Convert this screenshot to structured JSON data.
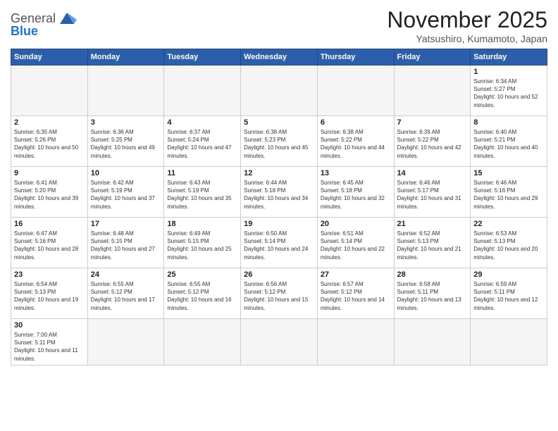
{
  "header": {
    "logo_general": "General",
    "logo_blue": "Blue",
    "title": "November 2025",
    "subtitle": "Yatsushiro, Kumamoto, Japan"
  },
  "weekdays": [
    "Sunday",
    "Monday",
    "Tuesday",
    "Wednesday",
    "Thursday",
    "Friday",
    "Saturday"
  ],
  "weeks": [
    [
      {
        "day": "",
        "info": ""
      },
      {
        "day": "",
        "info": ""
      },
      {
        "day": "",
        "info": ""
      },
      {
        "day": "",
        "info": ""
      },
      {
        "day": "",
        "info": ""
      },
      {
        "day": "",
        "info": ""
      },
      {
        "day": "1",
        "info": "Sunrise: 6:34 AM\nSunset: 5:27 PM\nDaylight: 10 hours and 52 minutes."
      }
    ],
    [
      {
        "day": "2",
        "info": "Sunrise: 6:35 AM\nSunset: 5:26 PM\nDaylight: 10 hours and 50 minutes."
      },
      {
        "day": "3",
        "info": "Sunrise: 6:36 AM\nSunset: 5:25 PM\nDaylight: 10 hours and 49 minutes."
      },
      {
        "day": "4",
        "info": "Sunrise: 6:37 AM\nSunset: 5:24 PM\nDaylight: 10 hours and 47 minutes."
      },
      {
        "day": "5",
        "info": "Sunrise: 6:38 AM\nSunset: 5:23 PM\nDaylight: 10 hours and 45 minutes."
      },
      {
        "day": "6",
        "info": "Sunrise: 6:38 AM\nSunset: 5:22 PM\nDaylight: 10 hours and 44 minutes."
      },
      {
        "day": "7",
        "info": "Sunrise: 6:39 AM\nSunset: 5:22 PM\nDaylight: 10 hours and 42 minutes."
      },
      {
        "day": "8",
        "info": "Sunrise: 6:40 AM\nSunset: 5:21 PM\nDaylight: 10 hours and 40 minutes."
      }
    ],
    [
      {
        "day": "9",
        "info": "Sunrise: 6:41 AM\nSunset: 5:20 PM\nDaylight: 10 hours and 39 minutes."
      },
      {
        "day": "10",
        "info": "Sunrise: 6:42 AM\nSunset: 5:19 PM\nDaylight: 10 hours and 37 minutes."
      },
      {
        "day": "11",
        "info": "Sunrise: 6:43 AM\nSunset: 5:19 PM\nDaylight: 10 hours and 35 minutes."
      },
      {
        "day": "12",
        "info": "Sunrise: 6:44 AM\nSunset: 5:18 PM\nDaylight: 10 hours and 34 minutes."
      },
      {
        "day": "13",
        "info": "Sunrise: 6:45 AM\nSunset: 5:18 PM\nDaylight: 10 hours and 32 minutes."
      },
      {
        "day": "14",
        "info": "Sunrise: 6:46 AM\nSunset: 5:17 PM\nDaylight: 10 hours and 31 minutes."
      },
      {
        "day": "15",
        "info": "Sunrise: 6:46 AM\nSunset: 5:16 PM\nDaylight: 10 hours and 29 minutes."
      }
    ],
    [
      {
        "day": "16",
        "info": "Sunrise: 6:47 AM\nSunset: 5:16 PM\nDaylight: 10 hours and 28 minutes."
      },
      {
        "day": "17",
        "info": "Sunrise: 6:48 AM\nSunset: 5:15 PM\nDaylight: 10 hours and 27 minutes."
      },
      {
        "day": "18",
        "info": "Sunrise: 6:49 AM\nSunset: 5:15 PM\nDaylight: 10 hours and 25 minutes."
      },
      {
        "day": "19",
        "info": "Sunrise: 6:50 AM\nSunset: 5:14 PM\nDaylight: 10 hours and 24 minutes."
      },
      {
        "day": "20",
        "info": "Sunrise: 6:51 AM\nSunset: 5:14 PM\nDaylight: 10 hours and 22 minutes."
      },
      {
        "day": "21",
        "info": "Sunrise: 6:52 AM\nSunset: 5:13 PM\nDaylight: 10 hours and 21 minutes."
      },
      {
        "day": "22",
        "info": "Sunrise: 6:53 AM\nSunset: 5:13 PM\nDaylight: 10 hours and 20 minutes."
      }
    ],
    [
      {
        "day": "23",
        "info": "Sunrise: 6:54 AM\nSunset: 5:13 PM\nDaylight: 10 hours and 19 minutes."
      },
      {
        "day": "24",
        "info": "Sunrise: 6:55 AM\nSunset: 5:12 PM\nDaylight: 10 hours and 17 minutes."
      },
      {
        "day": "25",
        "info": "Sunrise: 6:55 AM\nSunset: 5:12 PM\nDaylight: 10 hours and 16 minutes."
      },
      {
        "day": "26",
        "info": "Sunrise: 6:56 AM\nSunset: 5:12 PM\nDaylight: 10 hours and 15 minutes."
      },
      {
        "day": "27",
        "info": "Sunrise: 6:57 AM\nSunset: 5:12 PM\nDaylight: 10 hours and 14 minutes."
      },
      {
        "day": "28",
        "info": "Sunrise: 6:58 AM\nSunset: 5:11 PM\nDaylight: 10 hours and 13 minutes."
      },
      {
        "day": "29",
        "info": "Sunrise: 6:59 AM\nSunset: 5:11 PM\nDaylight: 10 hours and 12 minutes."
      }
    ],
    [
      {
        "day": "30",
        "info": "Sunrise: 7:00 AM\nSunset: 5:11 PM\nDaylight: 10 hours and 11 minutes."
      },
      {
        "day": "",
        "info": ""
      },
      {
        "day": "",
        "info": ""
      },
      {
        "day": "",
        "info": ""
      },
      {
        "day": "",
        "info": ""
      },
      {
        "day": "",
        "info": ""
      },
      {
        "day": "",
        "info": ""
      }
    ]
  ]
}
